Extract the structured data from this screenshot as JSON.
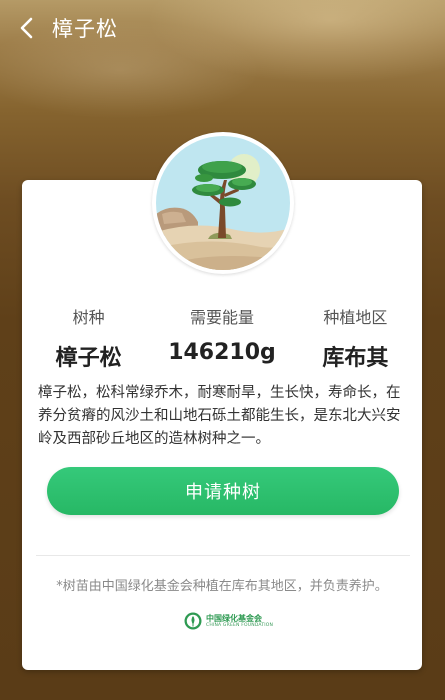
{
  "header": {
    "title": "樟子松"
  },
  "stats": [
    {
      "label": "树种",
      "value": "樟子松"
    },
    {
      "label": "需要能量",
      "value": "146210g"
    },
    {
      "label": "种植地区",
      "value": "库布其"
    }
  ],
  "description": "樟子松，松科常绿乔木，耐寒耐旱，生长快，寿命长，在养分贫瘠的风沙土和山地石砾土都能生长，是东北大兴安岭及西部砂丘地区的造林树种之一。",
  "actions": {
    "apply_label": "申请种树"
  },
  "footnote": "*树苗由中国绿化基金会种植在库布其地区，并负责养护。",
  "foundation": {
    "name_cn": "中国绿化基金会",
    "name_en": "CHINA GREEN FOUNDATION"
  },
  "colors": {
    "accent": "#2cc06e",
    "background": "#6e4d22"
  },
  "icons": {
    "back": "chevron-left-icon",
    "tree": "pine-tree-illustration",
    "foundation_logo": "foundation-logo-icon"
  }
}
